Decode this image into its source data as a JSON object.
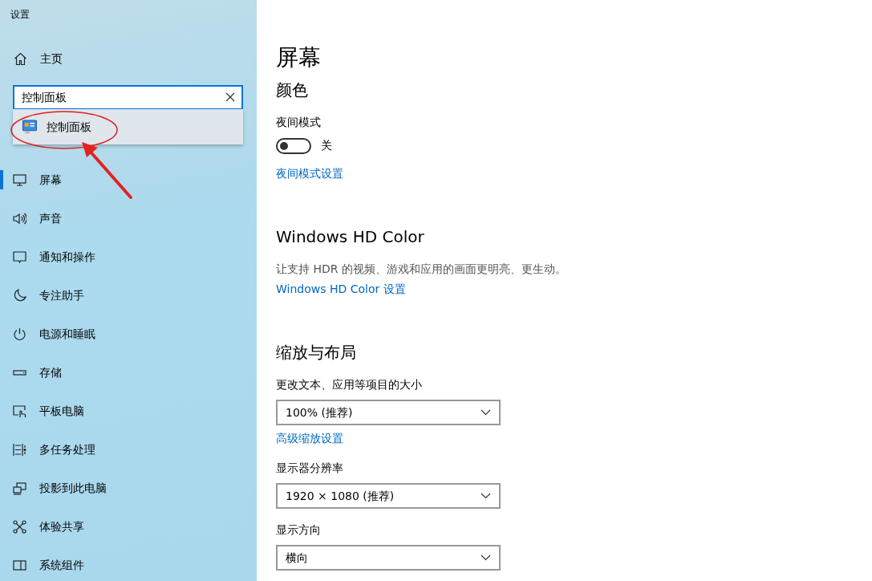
{
  "window": {
    "title": "设置"
  },
  "sidebar": {
    "home": "主页",
    "search": {
      "value": "控制面板",
      "suggestions": [
        {
          "label": "控制面板"
        }
      ]
    },
    "items": [
      {
        "label": "屏幕",
        "selected": true
      },
      {
        "label": "声音",
        "selected": false
      },
      {
        "label": "通知和操作",
        "selected": false
      },
      {
        "label": "专注助手",
        "selected": false
      },
      {
        "label": "电源和睡眠",
        "selected": false
      },
      {
        "label": "存储",
        "selected": false
      },
      {
        "label": "平板电脑",
        "selected": false
      },
      {
        "label": "多任务处理",
        "selected": false
      },
      {
        "label": "投影到此电脑",
        "selected": false
      },
      {
        "label": "体验共享",
        "selected": false
      },
      {
        "label": "系统组件",
        "selected": false
      }
    ]
  },
  "main": {
    "title": "屏幕",
    "blocks": [
      {
        "kind": "heading",
        "text": "颜色"
      },
      {
        "kind": "label",
        "text": "夜间模式"
      },
      {
        "kind": "toggle",
        "on": false,
        "text": "关"
      },
      {
        "kind": "link",
        "text": "夜间模式设置"
      },
      {
        "kind": "heading",
        "text": "Windows HD Color"
      },
      {
        "kind": "text",
        "text": "让支持 HDR 的视频、游戏和应用的画面更明亮、更生动。"
      },
      {
        "kind": "link",
        "text": "Windows HD Color 设置"
      },
      {
        "kind": "heading",
        "text": "缩放与布局"
      },
      {
        "kind": "label",
        "text": "更改文本、应用等项目的大小"
      },
      {
        "kind": "dropdown",
        "text": "100% (推荐)"
      },
      {
        "kind": "link",
        "text": "高级缩放设置"
      },
      {
        "kind": "label",
        "text": "显示器分辨率"
      },
      {
        "kind": "dropdown",
        "text": "1920 × 1080 (推荐)"
      },
      {
        "kind": "label",
        "text": "显示方向"
      },
      {
        "kind": "dropdown",
        "text": "横向"
      }
    ]
  }
}
